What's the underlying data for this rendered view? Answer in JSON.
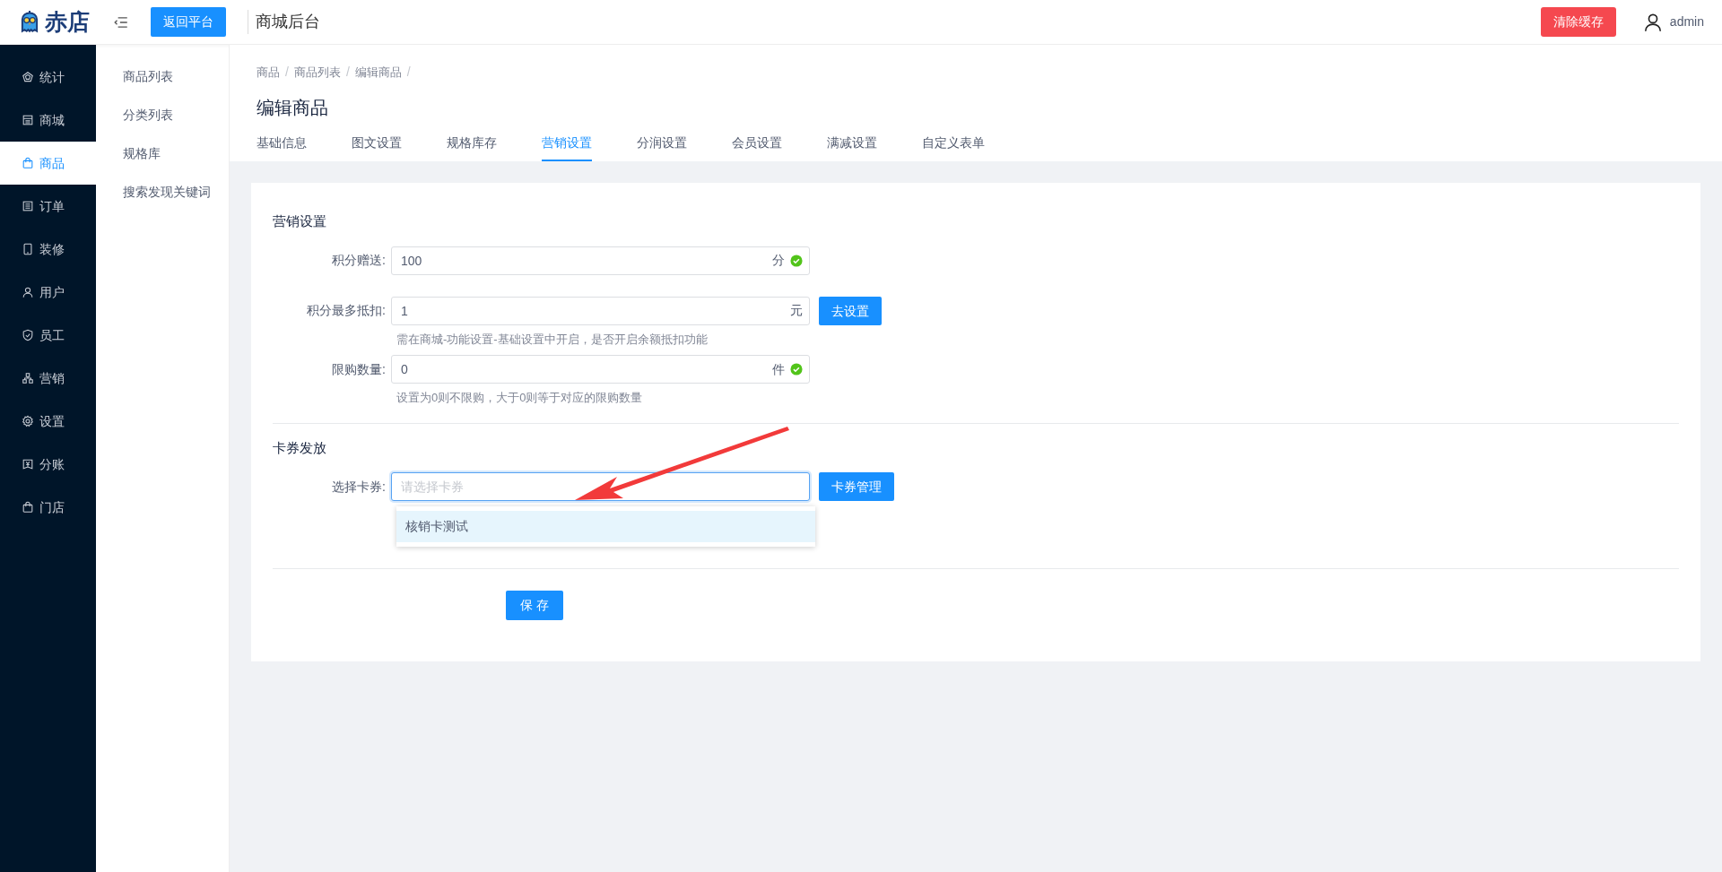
{
  "header": {
    "brand": "赤店",
    "back_button": "返回平台",
    "title": "商城后台",
    "clear_cache_button": "清除缓存",
    "user": "admin"
  },
  "sidebar": {
    "items": [
      {
        "label": "统计",
        "selected": false
      },
      {
        "label": "商城",
        "selected": false
      },
      {
        "label": "商品",
        "selected": true
      },
      {
        "label": "订单",
        "selected": false
      },
      {
        "label": "装修",
        "selected": false
      },
      {
        "label": "用户",
        "selected": false
      },
      {
        "label": "员工",
        "selected": false
      },
      {
        "label": "营销",
        "selected": false
      },
      {
        "label": "设置",
        "selected": false
      },
      {
        "label": "分账",
        "selected": false
      },
      {
        "label": "门店",
        "selected": false
      }
    ]
  },
  "subnav": {
    "items": [
      "商品列表",
      "分类列表",
      "规格库",
      "搜索发现关键词"
    ]
  },
  "breadcrumb": {
    "separator": "/",
    "items": [
      "商品",
      "商品列表",
      "编辑商品"
    ]
  },
  "page_title": "编辑商品",
  "tabs": [
    {
      "label": "基础信息",
      "selected": false
    },
    {
      "label": "图文设置",
      "selected": false
    },
    {
      "label": "规格库存",
      "selected": false
    },
    {
      "label": "营销设置",
      "selected": true
    },
    {
      "label": "分润设置",
      "selected": false
    },
    {
      "label": "会员设置",
      "selected": false
    },
    {
      "label": "满减设置",
      "selected": false
    },
    {
      "label": "自定义表单",
      "selected": false
    }
  ],
  "sections": [
    {
      "title": "营销设置",
      "fields": [
        {
          "label": "积分赠送:",
          "value": "100",
          "suffix": "分",
          "valid": true
        },
        {
          "label": "积分最多抵扣:",
          "value": "1",
          "suffix": "元",
          "valid": false,
          "button": "去设置",
          "hint": "需在商城-功能设置-基础设置中开启，是否开启余额抵扣功能"
        },
        {
          "label": "限购数量:",
          "value": "0",
          "suffix": "件",
          "valid": true,
          "hint": "设置为0则不限购，大于0则等于对应的限购数量"
        }
      ]
    },
    {
      "title": "卡券发放",
      "fields": [
        {
          "label": "选择卡券:",
          "placeholder": "请选择卡券",
          "focused": true,
          "button": "卡券管理",
          "options": [
            {
              "label": "核销卡测试",
              "highlighted": true
            }
          ]
        }
      ]
    }
  ],
  "save_button": "保 存"
}
